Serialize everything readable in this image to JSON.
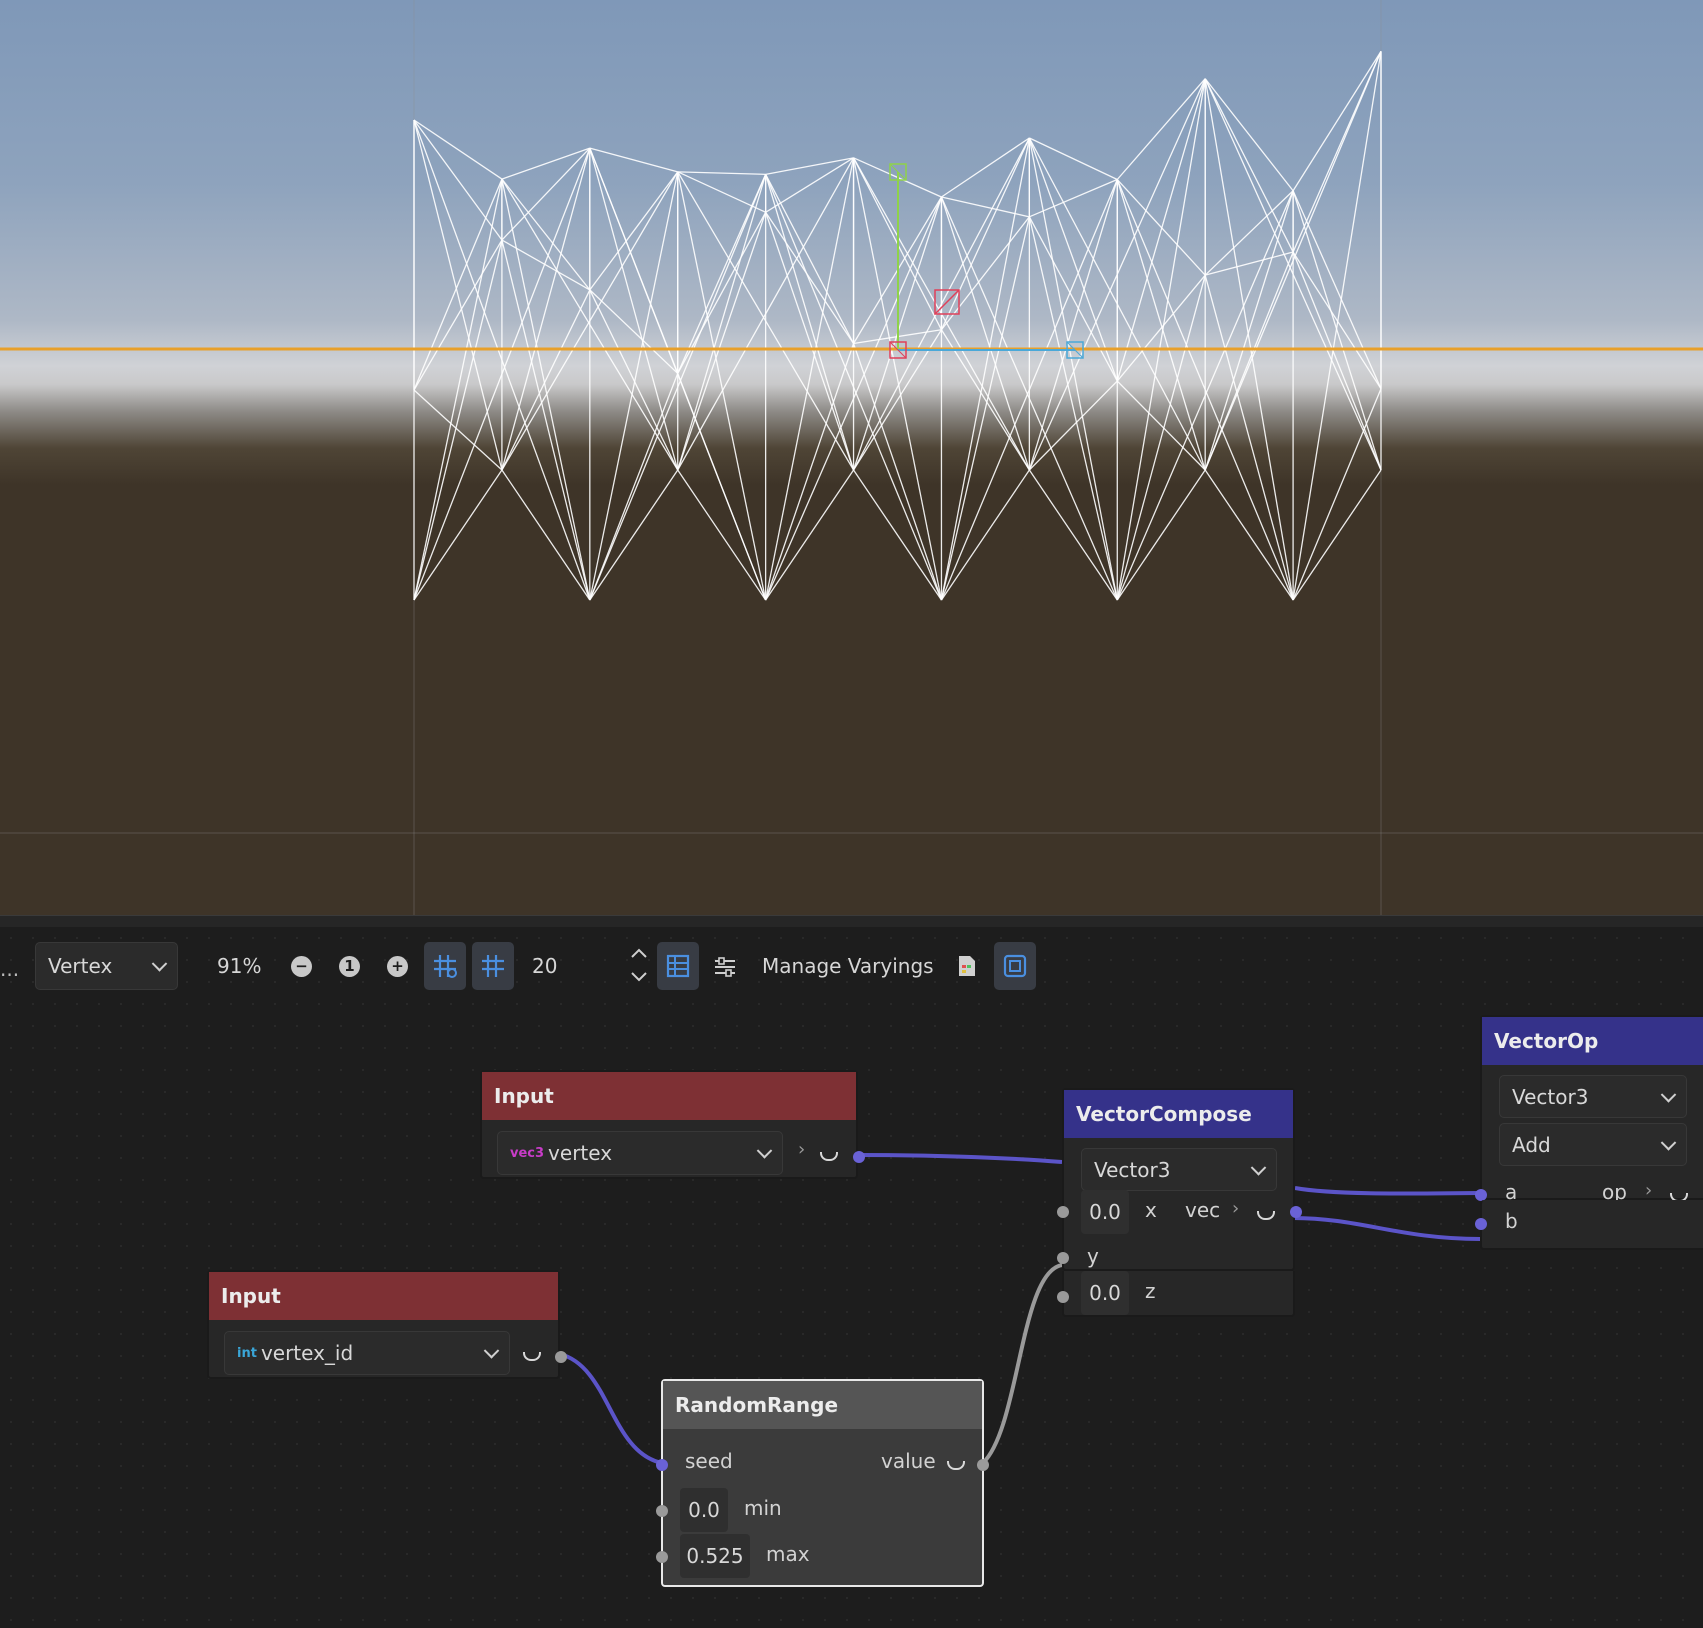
{
  "toolbar": {
    "ellipsis": "...",
    "shader_mode": "Vertex",
    "zoom": "91%",
    "zoom_out_icon": "minus-circle-icon",
    "zoom_reset_icon": "one-circle-icon",
    "zoom_in_icon": "plus-circle-icon",
    "snap_value": "20",
    "manage_varyings": "Manage Varyings"
  },
  "nodes": {
    "input_vertex": {
      "title": "Input",
      "type_tag": "vec3",
      "value": "vertex"
    },
    "input_vertex_id": {
      "title": "Input",
      "type_tag": "int",
      "value": "vertex_id"
    },
    "random_range": {
      "title": "RandomRange",
      "seed": "seed",
      "value": "value",
      "min_value": "0.0",
      "min_label": "min",
      "max_value": "0.525",
      "max_label": "max"
    },
    "vector_compose": {
      "title": "VectorCompose",
      "type": "Vector3",
      "x_value": "0.0",
      "x_label": "x",
      "vec_label": "vec",
      "y_label": "y",
      "z_value": "0.0",
      "z_label": "z"
    },
    "vector_op": {
      "title": "VectorOp",
      "type": "Vector3",
      "op_type": "Add",
      "a_label": "a",
      "op_label": "op",
      "b_label": "b"
    }
  },
  "colors": {
    "input_header": "#7e3034",
    "vector_header": "#35328a",
    "random_header": "#555555",
    "wire_purple": "#5b54c8",
    "horizon_line": "#e8a02a"
  }
}
